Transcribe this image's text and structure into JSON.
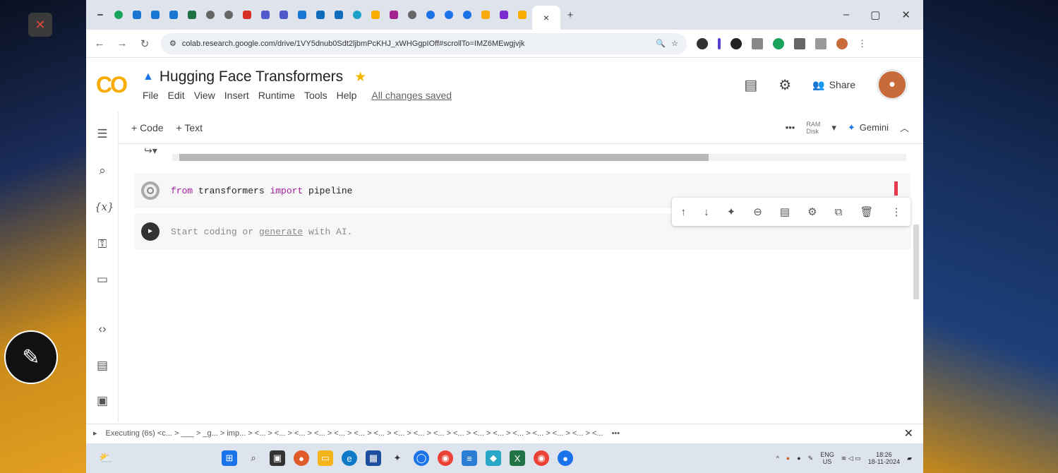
{
  "browser": {
    "url": "colab.research.google.com/drive/1VY5dnub0Sdt2ljbmPcKHJ_xWHGgpIOff#scrollTo=IMZ6MEwgjvjk",
    "window_controls": [
      "–",
      "▢",
      "✕"
    ],
    "new_tab": "+",
    "close_tab": "×"
  },
  "colab": {
    "logo": "CO",
    "title": "Hugging Face Transformers",
    "menu": [
      "File",
      "Edit",
      "View",
      "Insert",
      "Runtime",
      "Tools",
      "Help"
    ],
    "saved_status": "All changes saved",
    "share_label": "Share"
  },
  "toolbar": {
    "add_code": "+ Code",
    "add_text": "+ Text",
    "more": "•••",
    "ram": "RAM",
    "disk": "Disk",
    "gemini": "Gemini"
  },
  "cells": [
    {
      "code_parts": [
        "from",
        " transformers ",
        "import",
        " pipeline"
      ]
    },
    {
      "placeholder_a": "Start coding or ",
      "placeholder_link": "generate",
      "placeholder_b": " with AI."
    }
  ],
  "status": {
    "text": "Executing (6s) <c... > ___ > _g... > imp... > <... > <... > <... > <... > <... > <... > <... > <... > <... > <... > <... > <... > <... > <... > <... > <... > <... > <...",
    "more": "•••"
  },
  "tray": {
    "lang": "ENG",
    "region": "US",
    "time": "18:26",
    "date": "18-11-2024"
  },
  "icons": {
    "rail": [
      "toc-icon",
      "search-icon",
      "variables-icon",
      "key-icon",
      "folder-icon",
      "code-snippets-icon",
      "command-palette-icon",
      "terminal-icon"
    ],
    "cell_toolbar": [
      "↑",
      "↓",
      "✦",
      "⊖",
      "▤",
      "⚙",
      "⧉",
      "🗑",
      "⋮"
    ]
  },
  "colors": {
    "accent": "#1a73e8",
    "logo_orange": "#f9ab00",
    "cursor_red": "#e53950"
  }
}
